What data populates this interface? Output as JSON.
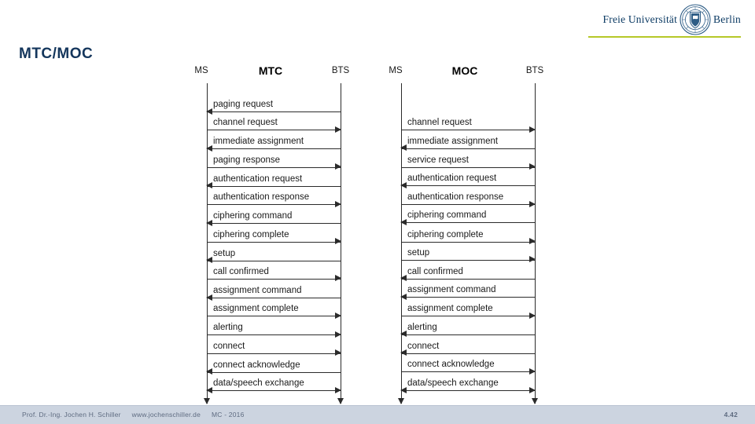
{
  "logo": {
    "text_left": "Freie Universität",
    "text_right": "Berlin",
    "seal_name": "fu-berlin-seal",
    "accent_color": "#b6c828",
    "text_color": "#0b3a63"
  },
  "slide": {
    "title": "MTC/MOC",
    "title_color": "#14365c"
  },
  "diagrams": [
    {
      "id": "mtc",
      "center_title": "MTC",
      "left_actor": "MS",
      "right_actor": "BTS",
      "messages": [
        {
          "label": "paging request",
          "direction": "left"
        },
        {
          "label": "channel request",
          "direction": "right"
        },
        {
          "label": "immediate assignment",
          "direction": "left"
        },
        {
          "label": "paging response",
          "direction": "right"
        },
        {
          "label": "authentication request",
          "direction": "left"
        },
        {
          "label": "authentication response",
          "direction": "right"
        },
        {
          "label": "ciphering command",
          "direction": "left"
        },
        {
          "label": "ciphering complete",
          "direction": "right"
        },
        {
          "label": "setup",
          "direction": "left"
        },
        {
          "label": "call confirmed",
          "direction": "right"
        },
        {
          "label": "assignment command",
          "direction": "left"
        },
        {
          "label": "assignment complete",
          "direction": "right"
        },
        {
          "label": "alerting",
          "direction": "right"
        },
        {
          "label": "connect",
          "direction": "right"
        },
        {
          "label": "connect acknowledge",
          "direction": "left"
        },
        {
          "label": "data/speech exchange",
          "direction": "both"
        }
      ]
    },
    {
      "id": "moc",
      "center_title": "MOC",
      "left_actor": "MS",
      "right_actor": "BTS",
      "messages": [
        {
          "label": "channel request",
          "direction": "right"
        },
        {
          "label": "immediate assignment",
          "direction": "left"
        },
        {
          "label": "service request",
          "direction": "right"
        },
        {
          "label": "authentication request",
          "direction": "left"
        },
        {
          "label": "authentication response",
          "direction": "right"
        },
        {
          "label": "ciphering command",
          "direction": "left"
        },
        {
          "label": "ciphering complete",
          "direction": "right"
        },
        {
          "label": "setup",
          "direction": "right"
        },
        {
          "label": "call confirmed",
          "direction": "left"
        },
        {
          "label": "assignment command",
          "direction": "left"
        },
        {
          "label": "assignment complete",
          "direction": "right"
        },
        {
          "label": "alerting",
          "direction": "left"
        },
        {
          "label": "connect",
          "direction": "left"
        },
        {
          "label": "connect acknowledge",
          "direction": "right"
        },
        {
          "label": "data/speech exchange",
          "direction": "both"
        }
      ]
    }
  ],
  "footer": {
    "author": "Prof. Dr.-Ing. Jochen H. Schiller",
    "website": "www.jochenschiller.de",
    "course": "MC - 2016",
    "page_number": "4.42",
    "background_color": "#ccd4e0",
    "text_color": "#5e6b80"
  }
}
